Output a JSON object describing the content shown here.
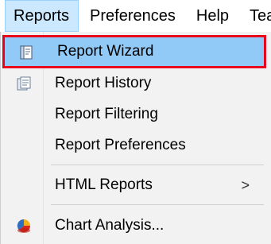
{
  "menubar": {
    "items": [
      "Reports",
      "Preferences",
      "Help",
      "Tea"
    ]
  },
  "menu": {
    "items": [
      {
        "label": "Report Wizard",
        "icon": "report-wizard-icon",
        "highlighted": true
      },
      {
        "label": "Report History",
        "icon": "report-history-icon"
      },
      {
        "label": "Report Filtering"
      },
      {
        "label": "Report Preferences"
      },
      {
        "label": "HTML Reports",
        "submenu_glyph": ">"
      },
      {
        "label": "Chart Analysis...",
        "icon": "chart-analysis-icon"
      }
    ]
  },
  "colors": {
    "highlight_bg": "#91c9f7",
    "highlight_border": "#e8001c",
    "menu_bg": "#f2f2f2",
    "active_menubar_bg": "#cce8ff"
  }
}
